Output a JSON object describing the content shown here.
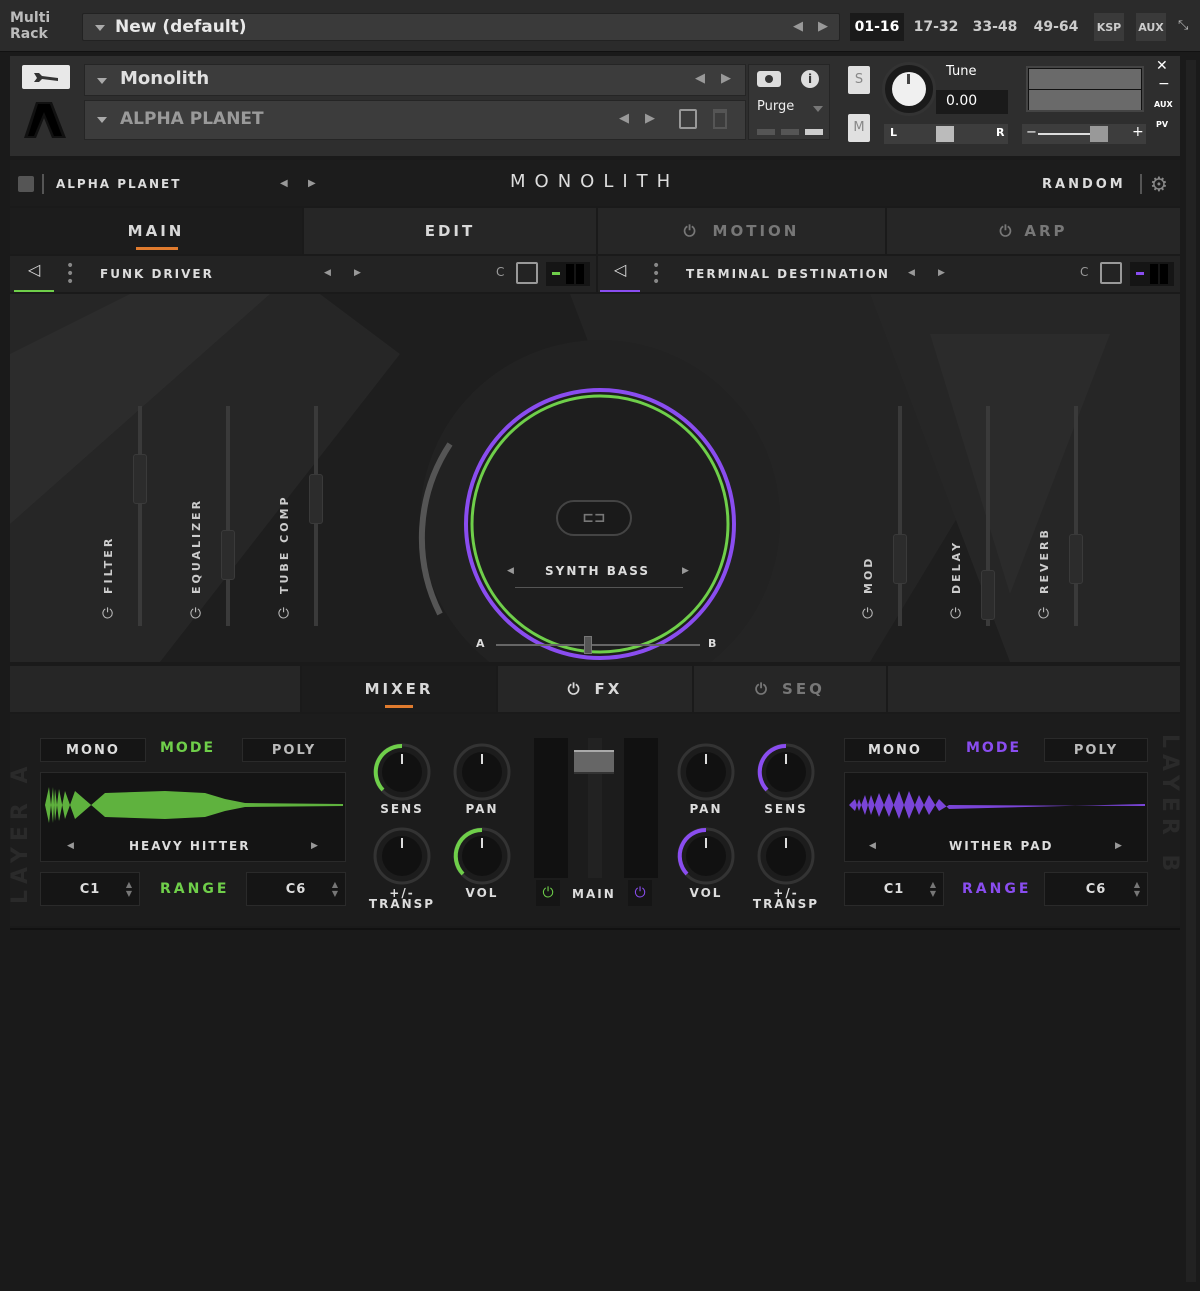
{
  "topbar": {
    "multi_rack": "Multi\nRack",
    "rack_name": "New (default)",
    "ranges": [
      "01-16",
      "17-32",
      "33-48",
      "49-64",
      "KSP",
      "AUX"
    ]
  },
  "instrument": {
    "name": "Monolith",
    "preset": "ALPHA PLANET",
    "purge": "Purge",
    "tune_label": "Tune",
    "tune_value": "0.00",
    "solo": "S",
    "mute": "M",
    "pan_l": "L",
    "pan_r": "R",
    "aux": "AUX",
    "pv": "PV"
  },
  "titlebar": {
    "preset": "ALPHA PLANET",
    "title": "MONOLITH",
    "random": "RANDOM"
  },
  "tabs": [
    "MAIN",
    "EDIT",
    "MOTION",
    "ARP"
  ],
  "layers": {
    "a": "FUNK DRIVER",
    "b": "TERMINAL DESTINATION"
  },
  "stage": {
    "left_fx": [
      "FILTER",
      "EQUALIZER",
      "TUBE COMP"
    ],
    "right_fx": [
      "MOD",
      "DELAY",
      "REVERB"
    ],
    "center": "SYNTH BASS",
    "a": "A",
    "b": "B",
    "morph": 0.45
  },
  "subtabs": [
    "MIXER",
    "FX",
    "SEQ"
  ],
  "mixer": {
    "left": {
      "mono": "MONO",
      "mode": "MODE",
      "poly": "POLY",
      "sample": "HEAVY HITTER",
      "range_lo": "C1",
      "range": "RANGE",
      "range_hi": "C6",
      "side": "LAYER A"
    },
    "right": {
      "mono": "MONO",
      "mode": "MODE",
      "poly": "POLY",
      "sample": "WITHER PAD",
      "range_lo": "C1",
      "range": "RANGE",
      "range_hi": "C6",
      "side": "LAYER B"
    },
    "knobs_left": [
      "SENS",
      "PAN",
      "+/-\nTRANSP",
      "VOL"
    ],
    "knobs_right": [
      "PAN",
      "SENS",
      "VOL",
      "+/-\nTRANSP"
    ],
    "main": "MAIN"
  },
  "colors": {
    "green": "#6fcf4a",
    "purple": "#8a4df0",
    "orange": "#e07b2e",
    "bg": "#1a1a1a"
  }
}
